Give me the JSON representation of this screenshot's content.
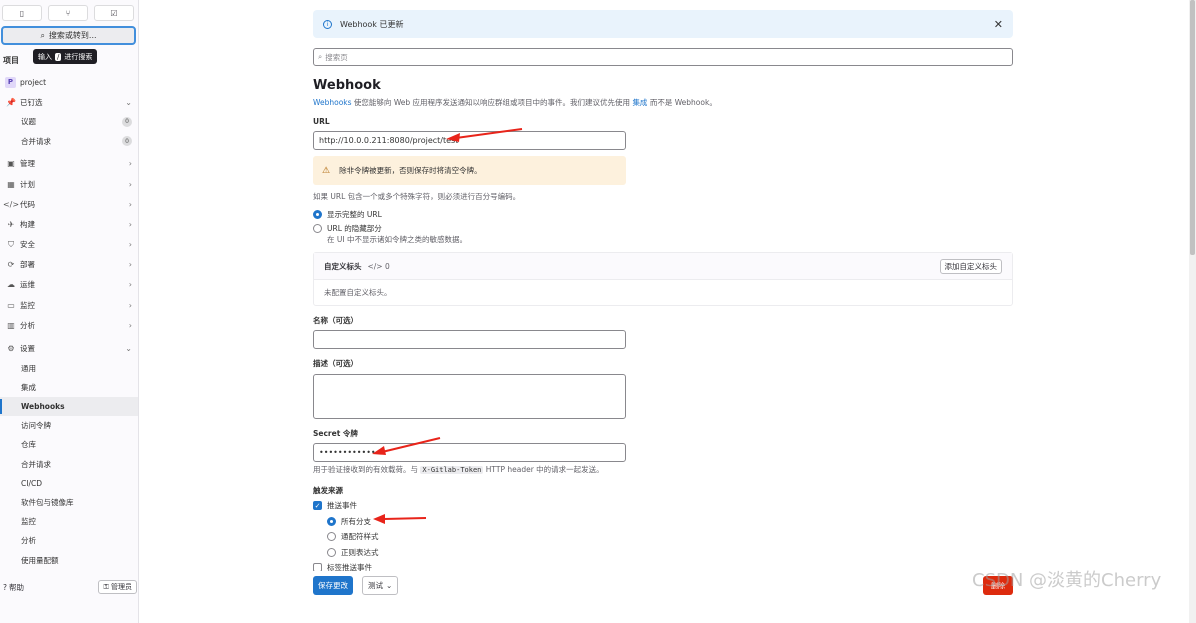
{
  "sidebar": {
    "top_icons": [
      "issues-icon",
      "merge-request-icon",
      "todo-icon"
    ],
    "search_label": "搜索或转到...",
    "tooltip_prefix": "输入",
    "tooltip_key": "/",
    "tooltip_suffix": "进行搜索",
    "heading": "项目",
    "project": {
      "avatar": "P",
      "name": "project"
    },
    "pinned": {
      "label": "已钉选"
    },
    "pinned_items": [
      {
        "label": "议题",
        "count": "0"
      },
      {
        "label": "合并请求",
        "count": "0"
      }
    ],
    "groups": [
      {
        "label": "管理",
        "icon": "briefcase-icon"
      },
      {
        "label": "计划",
        "icon": "calendar-icon"
      },
      {
        "label": "代码",
        "icon": "code-icon"
      },
      {
        "label": "构建",
        "icon": "rocket-icon"
      },
      {
        "label": "安全",
        "icon": "shield-icon"
      },
      {
        "label": "部署",
        "icon": "deploy-icon"
      },
      {
        "label": "运维",
        "icon": "cloud-icon"
      },
      {
        "label": "监控",
        "icon": "monitor-icon"
      },
      {
        "label": "分析",
        "icon": "chart-icon"
      }
    ],
    "settings": {
      "label": "设置"
    },
    "settings_items": [
      "通用",
      "集成",
      "Webhooks",
      "访问令牌",
      "仓库",
      "合并请求",
      "CI/CD",
      "软件包与镜像库",
      "监控",
      "分析",
      "使用量配额"
    ],
    "active_settings_item": "Webhooks",
    "help_label": "帮助",
    "admin_label": "管理员"
  },
  "main": {
    "alert_text": "Webhook 已更新",
    "search_placeholder": "搜索页",
    "title": "Webhook",
    "desc_link1": "Webhooks",
    "desc_mid": " 使您能够向 Web 应用程序发送通知以响应群组或项目中的事件。我们建议优先使用 ",
    "desc_link2": "集成",
    "desc_end": " 而不是 Webhook。",
    "url_label": "URL",
    "url_value": "http://10.0.0.211:8080/project/test",
    "warning_text": "除非令牌被更新，否则保存时将清空令牌。",
    "url_note": "如果 URL 包含一个或多个特殊字符，则必须进行百分号编码。",
    "radio_show_url": "显示完整的 URL",
    "radio_mask_url": "URL 的隐藏部分",
    "mask_note": "在 UI 中不显示诸如令牌之类的敏感数据。",
    "custom_headers_title": "自定义标头",
    "custom_headers_count": "0",
    "add_header_label": "添加自定义标头",
    "no_headers_text": "未配置自定义标头。",
    "name_label": "名称（可选）",
    "name_value": "",
    "description_label": "描述（可选）",
    "secret_label": "Secret 令牌",
    "secret_value": "••••••••••••",
    "secret_note_pre": "用于验证接收到的有效载荷。与 ",
    "secret_note_code": "X-Gitlab-Token",
    "secret_note_post": " HTTP header 中的请求一起发送。",
    "trigger_label": "触发来源",
    "push_events_label": "推送事件",
    "branch_options": [
      "所有分支",
      "通配符样式",
      "正则表达式"
    ],
    "selected_branch_option": "所有分支",
    "tag_push_label": "标签推送事件",
    "save_label": "保存更改",
    "test_label": "测试",
    "delete_label": "删除"
  },
  "watermark": "CSDN @淡黄的Cherry",
  "colors": {
    "accent": "#1f75cb",
    "annotation_arrow": "#e8241a",
    "delete": "#dd2b0e",
    "alert_bg": "#e9f3fc",
    "warning_bg": "#fdf1dd"
  }
}
